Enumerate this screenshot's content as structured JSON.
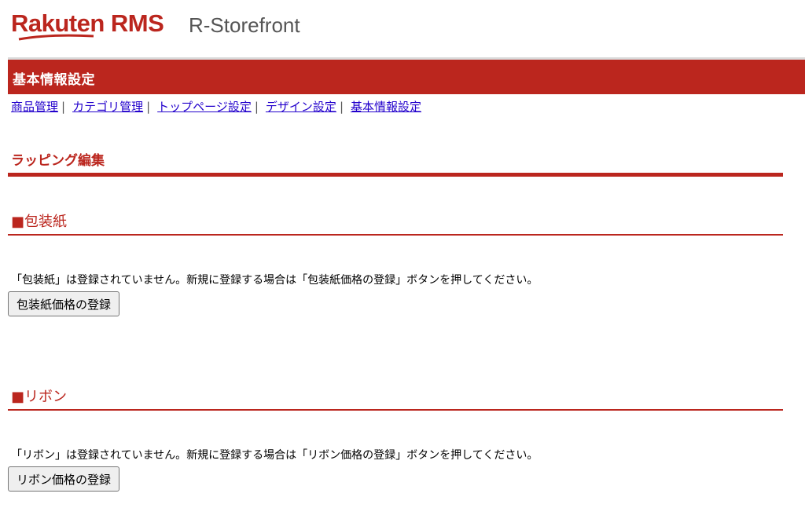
{
  "brand": {
    "name": "Rakuten RMS",
    "product": "R-Storefront",
    "color": "#bb261e"
  },
  "header": {
    "title": "基本情報設定"
  },
  "nav": {
    "items": [
      {
        "label": "商品管理"
      },
      {
        "label": "カテゴリ管理"
      },
      {
        "label": "トップページ設定"
      },
      {
        "label": "デザイン設定"
      },
      {
        "label": "基本情報設定"
      }
    ],
    "separator": "|"
  },
  "page": {
    "title": "ラッピング編集"
  },
  "sections": [
    {
      "title": "■包装紙",
      "message": "「包装紙」は登録されていません。新規に登録する場合は「包装紙価格の登録」ボタンを押してください。",
      "button_label": "包装紙価格の登録"
    },
    {
      "title": "■リボン",
      "message": "「リボン」は登録されていません。新規に登録する場合は「リボン価格の登録」ボタンを押してください。",
      "button_label": "リボン価格の登録"
    }
  ]
}
